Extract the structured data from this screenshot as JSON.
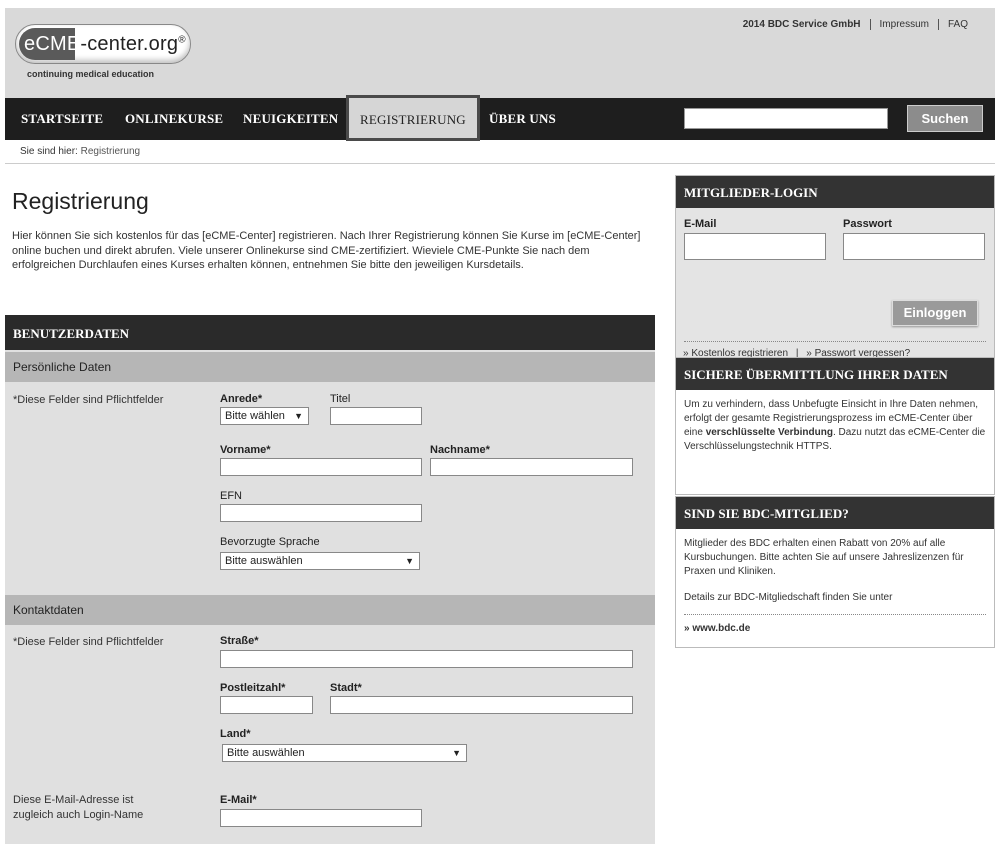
{
  "header": {
    "logo_prefix": "eCME",
    "logo_rest": "-center.org",
    "logo_reg": "®",
    "logo_sub": "continuing medical education",
    "links": [
      "2014 BDC Service GmbH",
      "Impressum",
      "FAQ"
    ]
  },
  "nav": {
    "items": [
      "STARTSEITE",
      "ONLINEKURSE",
      "NEUIGKEITEN",
      "REGISTRIERUNG",
      "ÜBER UNS"
    ],
    "active": "REGISTRIERUNG",
    "search_value": "",
    "search_button": "Suchen"
  },
  "breadcrumb": {
    "prefix": "Sie sind hier:",
    "current": "Registrierung"
  },
  "main": {
    "title": "Registrierung",
    "intro": "Hier können Sie sich kostenlos für das [eCME-Center] registrieren. Nach Ihrer Registrierung können Sie Kurse im [eCME-Center] online buchen und direkt abrufen. Viele unserer Onlinekurse sind CME-zertifiziert. Wieviele CME-Punkte Sie nach dem erfolgreichen Durchlaufen eines Kurses erhalten können, entnehmen Sie bitte den jeweiligen Kursdetails.",
    "panel_title": "BENUTZERDATEN",
    "personal": {
      "heading": "Persönliche Daten",
      "required_note": "*Diese Felder sind Pflichtfelder",
      "anrede_label": "Anrede*",
      "anrede_value": "Bitte wählen",
      "titel_label": "Titel",
      "vorname_label": "Vorname*",
      "nachname_label": "Nachname*",
      "efn_label": "EFN",
      "sprache_label": "Bevorzugte Sprache",
      "sprache_value": "Bitte auswählen"
    },
    "contact": {
      "heading": "Kontaktdaten",
      "required_note": "*Diese Felder sind Pflichtfelder",
      "strasse_label": "Straße*",
      "plz_label": "Postleitzahl*",
      "stadt_label": "Stadt*",
      "land_label": "Land*",
      "land_value": "Bitte auswählen",
      "email_note_1": "Diese E-Mail-Adresse ist",
      "email_note_2": "zugleich auch Login-Name",
      "email_label": "E-Mail*"
    }
  },
  "sidebar": {
    "login": {
      "title": "MITGLIEDER-LOGIN",
      "email_label": "E-Mail",
      "password_label": "Passwort",
      "button": "Einloggen",
      "register_link": "Kostenlos registrieren",
      "forgot_link": "Passwort vergessen?"
    },
    "secure": {
      "title": "SICHERE ÜBERMITTLUNG IHRER DATEN",
      "text_1": "Um zu verhindern, dass Unbefugte Einsicht in Ihre Daten nehmen, erfolgt der gesamte Registrierungsprozess im eCME-Center über eine ",
      "text_bold": "verschlüsselte Verbindung",
      "text_2": ". Dazu nutzt das eCME-Center die Verschlüsselungstechnik HTTPS."
    },
    "bdc": {
      "title": "SIND SIE BDC-MITGLIED?",
      "text": "Mitglieder des BDC erhalten einen Rabatt von 20% auf alle Kursbuchungen. Bitte achten Sie auf unsere Jahreslizenzen für Praxen und Kliniken.",
      "details": "Details zur BDC-Mitgliedschaft finden Sie unter",
      "link": "www.bdc.de"
    }
  }
}
